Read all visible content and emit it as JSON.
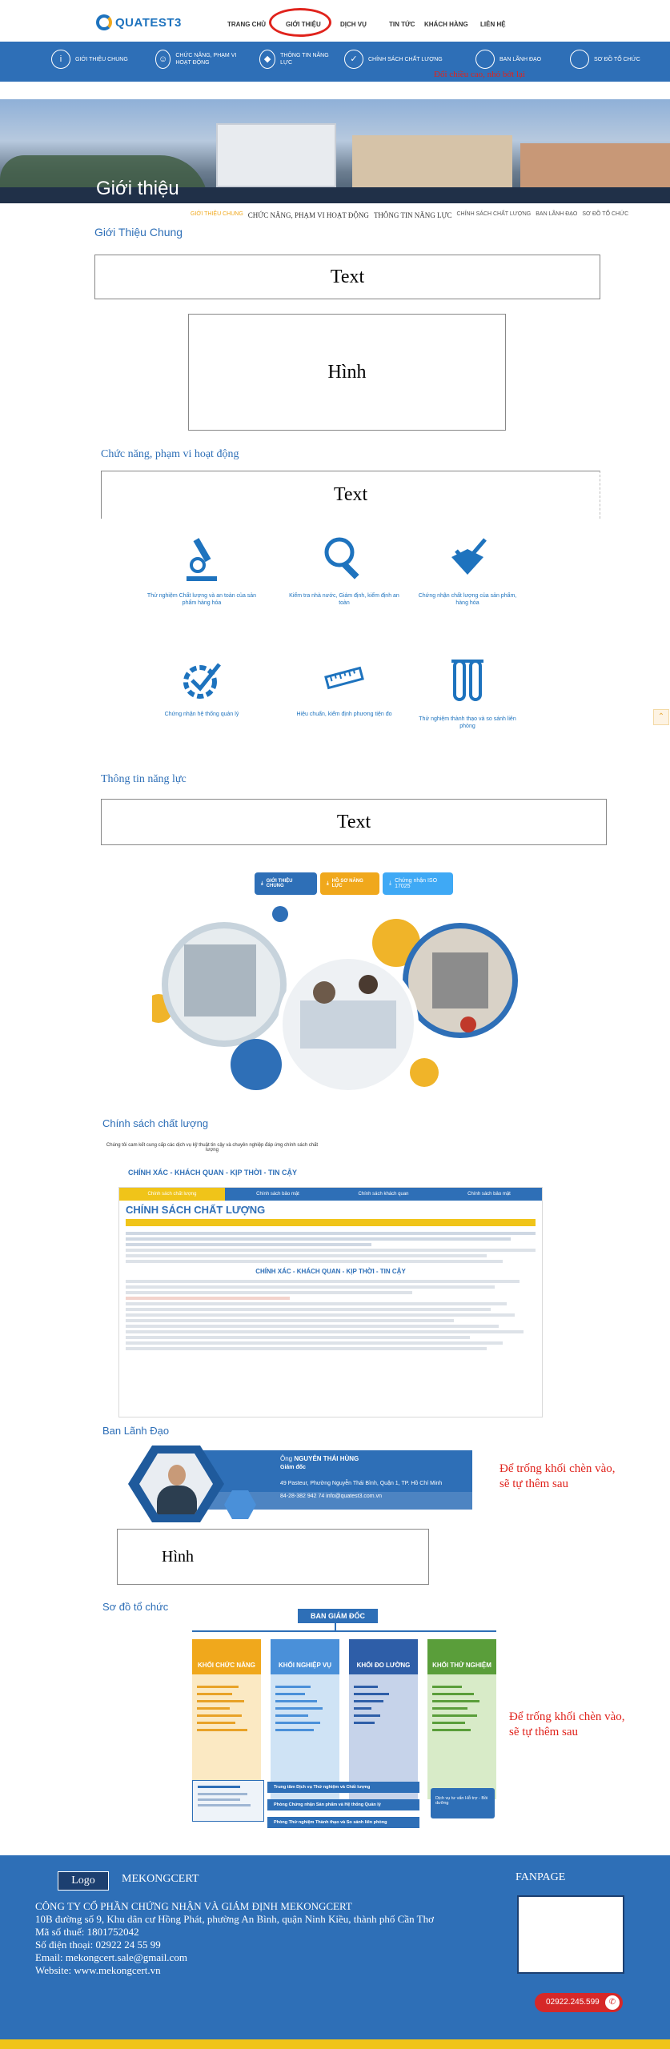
{
  "header": {
    "logo_text": "QUATEST3",
    "nav": [
      "TRANG CHỦ",
      "GIỚI THIỆU",
      "DỊCH VỤ",
      "TIN TỨC",
      "KHÁCH HÀNG",
      "LIÊN HỆ"
    ]
  },
  "subnav": {
    "items": [
      {
        "label": "GIỚI THIỆU CHUNG",
        "icon": "info-icon"
      },
      {
        "label": "CHỨC NĂNG, PHẠM VI HOẠT ĐỘNG",
        "icon": "user-icon"
      },
      {
        "label": "THÔNG TIN NĂNG LỰC",
        "icon": "shield-icon"
      },
      {
        "label": "CHÍNH SÁCH CHẤT LƯỢNG",
        "icon": "check-icon"
      },
      {
        "label": "BAN LÃNH ĐẠO",
        "icon": "people-icon"
      },
      {
        "label": "SƠ ĐỒ TỔ CHỨC",
        "icon": "org-icon"
      }
    ],
    "note": "Đổi chiều cao, nhỏ bớt lại"
  },
  "hero": {
    "title": "Giới thiệu"
  },
  "tabs": [
    "GIỚI THIỆU CHUNG",
    "CHỨC NĂNG, PHẠM VI HOẠT ĐỘNG",
    "THÔNG TIN NĂNG LỰC",
    "CHÍNH SÁCH CHẤT LƯỢNG",
    "BAN LÃNH ĐẠO",
    "SƠ ĐỒ TỔ CHỨC"
  ],
  "sections": {
    "intro": {
      "title": "Giới Thiệu Chung",
      "text_box": "Text",
      "image_box": "Hình"
    },
    "functions": {
      "title": "Chức năng, phạm vi hoạt động",
      "text_box": "Text",
      "features": [
        {
          "label": "Thử nghiệm Chất lượng và an toàn của sản phẩm hàng hóa",
          "icon": "microscope-icon"
        },
        {
          "label": "Kiểm tra nhà nước, Giám định, kiểm định an toàn",
          "icon": "magnifier-icon"
        },
        {
          "label": "Chứng nhận chất lượng của sản phẩm, hàng hóa",
          "icon": "checkbox-icon"
        },
        {
          "label": "Chứng nhận hệ thống quản lý",
          "icon": "gear-check-icon"
        },
        {
          "label": "Hiệu chuẩn, kiểm định phương tiện đo",
          "icon": "ruler-icon"
        },
        {
          "label": "Thử nghiệm thành thạo và so sánh liên phòng",
          "icon": "test-tube-icon"
        }
      ]
    },
    "capacity": {
      "title": "Thông tin năng lực",
      "text_box": "Text",
      "buttons": [
        "GIỚI THIỆU CHUNG",
        "HỒ SƠ NĂNG LỰC",
        "Chứng nhận ISO 17025"
      ]
    },
    "policy": {
      "title": "Chính sách chất lượng",
      "intro": "Chúng tôi cam kết cung cấp các dịch vụ kỹ thuật tin cậy và chuyên nghiệp đáp ứng chính sách chất lượng",
      "slogan": "CHÍNH XÁC - KHÁCH QUAN - KỊP THỜI - TIN CẬY",
      "tab_labels": [
        "Chính sách chất lượng",
        "Chính sách bảo mật",
        "Chính sách khách quan",
        "Chính sách bảo mật"
      ],
      "doc_title": "CHÍNH SÁCH CHẤT LƯỢNG",
      "doc_subtitle": "CHÍNH XÁC - KHÁCH QUAN - KỊP THỜI - TIN CẬY"
    },
    "leadership": {
      "title": "Ban Lãnh Đạo",
      "person_prefix": "Ông",
      "person_name": "NGUYỄN THÁI HÙNG",
      "person_role": "Giám đốc",
      "address": "49 Pasteur, Phường Nguyễn Thái Bình, Quận 1, TP. Hồ Chí Minh",
      "contact": "84-28-382 942 74   info@quatest3.com.vn",
      "image_box": "Hình",
      "note_line1": "Để trống khối chèn vào,",
      "note_line2": "sẽ tự thêm sau"
    },
    "org": {
      "title": "Sơ đồ tổ chức",
      "top": "BAN GIÁM ĐỐC",
      "columns": [
        {
          "title": "KHỐI CHỨC NĂNG",
          "color": "#f0a81c"
        },
        {
          "title": "KHỐI NGHIỆP VỤ",
          "color": "#4a90d9"
        },
        {
          "title": "KHỐI ĐO LƯỜNG",
          "color": "#2e5ea8"
        },
        {
          "title": "KHỐI THỬ NGHIỆM",
          "color": "#5a9e3a"
        }
      ],
      "bottom_rows": [
        "Trung tâm Dịch vụ Thử nghiệm và Chất lượng",
        "Phòng Chứng nhận Sản phẩm và Hệ thống Quản lý",
        "Phòng Thử nghiệm Thành thạo và So sánh liên phòng"
      ],
      "side_box": "Dịch vụ tư vấn Hỗ trợ - Bồi dưỡng",
      "note_line1": "Để trống khối chèn vào,",
      "note_line2": "sẽ tự thêm sau"
    }
  },
  "footer": {
    "logo": "Logo",
    "brand": "MEKONGCERT",
    "company": "CÔNG TY CỔ PHẦN CHỨNG NHẬN VÀ GIÁM ĐỊNH MEKONGCERT",
    "address": "10B đường số 9, Khu dân cư Hồng Phát, phường An Bình, quận Ninh Kiều, thành phố Cần Thơ",
    "tax": "Mã số thuế: 1801752042",
    "phone": "Số điện thoại: 02922 24 55 99",
    "email": "Email: mekongcert.sale@gmail.com",
    "website": "Website: www.mekongcert.vn",
    "fanpage": "FANPAGE",
    "hotline": "02922.245.599"
  },
  "colors": {
    "primary": "#2e6fb7",
    "accent": "#f0a81c",
    "alert": "#e0231c"
  }
}
